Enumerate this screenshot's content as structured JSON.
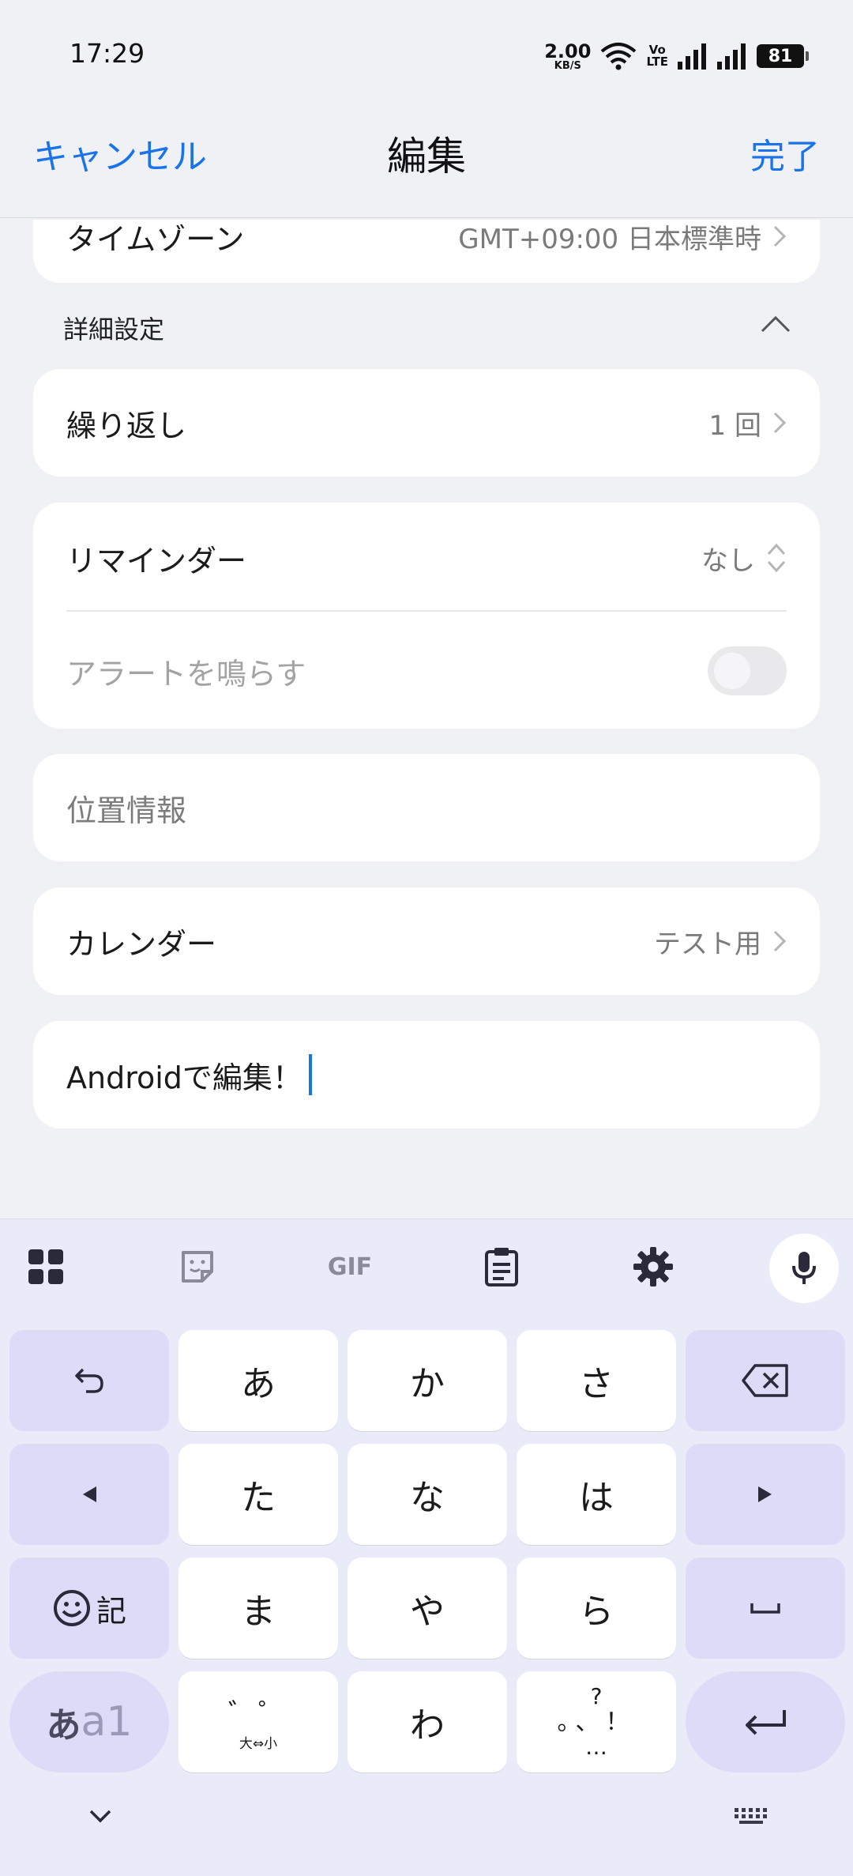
{
  "status_bar": {
    "time": "17:29",
    "net_speed_value": "2.00",
    "net_speed_unit": "KB/S",
    "volte_line1": "Vo",
    "volte_line2": "LTE",
    "battery": "81"
  },
  "nav": {
    "cancel_label": "キャンセル",
    "title": "編集",
    "done_label": "完了"
  },
  "timezone": {
    "label": "タイムゾーン",
    "value": "GMT+09:00 日本標準時"
  },
  "advanced": {
    "title": "詳細設定"
  },
  "repeat": {
    "label": "繰り返し",
    "value": "1 回"
  },
  "reminder": {
    "label": "リマインダー",
    "value": "なし"
  },
  "alert": {
    "label": "アラートを鳴らす",
    "enabled": false
  },
  "location": {
    "placeholder": "位置情報"
  },
  "calendar": {
    "label": "カレンダー",
    "value": "テスト用"
  },
  "note": {
    "value": "Androidで編集！"
  },
  "keyboard": {
    "toolbar": {
      "gif_label": "GIF"
    },
    "rows": [
      [
        "あ",
        "か",
        "さ"
      ],
      [
        "た",
        "な",
        "は"
      ],
      [
        "ま",
        "や",
        "ら"
      ]
    ],
    "kigou_label": "記",
    "mode_label_kana": "あ",
    "mode_label_alnum": "a1",
    "dakuten_main": "゛゜",
    "dakuten_sub": "大⇔小",
    "wa_key": "わ",
    "punct_top": "?",
    "punct_mid": "。、！",
    "punct_bottom": "…"
  },
  "colors": {
    "accent": "#1a73e8",
    "background": "#eff1f4",
    "keyboard_bg": "#eaebf9",
    "fn_key": "#dcdcf8"
  }
}
